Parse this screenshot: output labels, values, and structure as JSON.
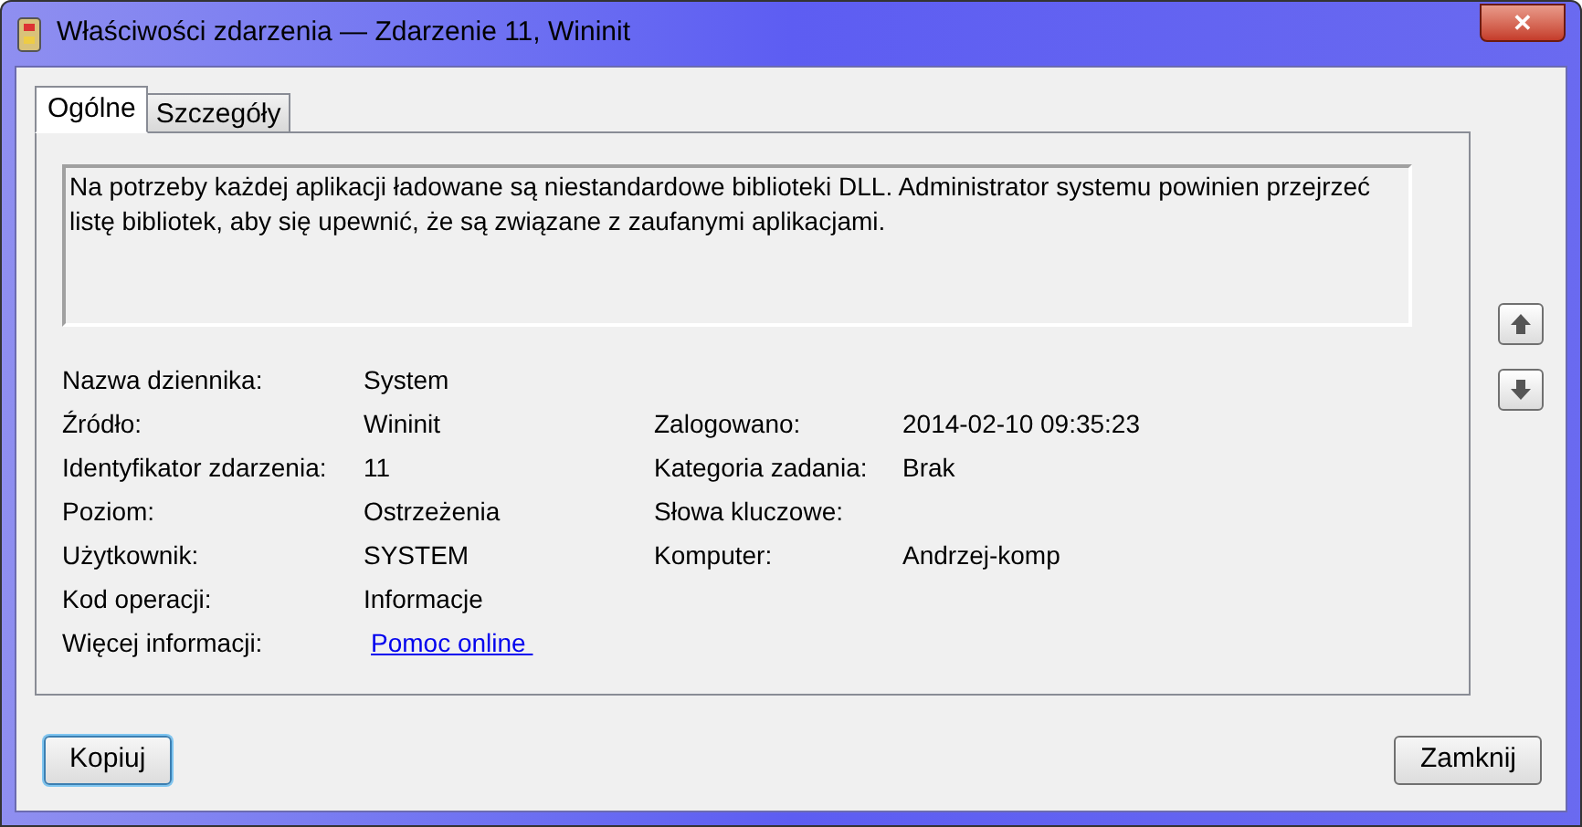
{
  "window": {
    "title": "Właściwości zdarzenia — Zdarzenie 11, Wininit",
    "close": "✕"
  },
  "tabs": [
    {
      "label": "Ogólne",
      "selected": true
    },
    {
      "label": "Szczegóły",
      "selected": false
    }
  ],
  "description": "Na potrzeby każdej aplikacji ładowane są niestandardowe biblioteki DLL. Administrator systemu powinien przejrzeć listę bibliotek, aby się upewnić, że są związane z zaufanymi aplikacjami.",
  "fields_left": [
    {
      "label": "Nazwa dziennika:",
      "value": "System",
      "kind": "text"
    },
    {
      "label": "Źródło:",
      "value": "Wininit",
      "kind": "text"
    },
    {
      "label": "Identyfikator zdarzenia:",
      "value": "11",
      "kind": "text"
    },
    {
      "label": "Poziom:",
      "value": "Ostrzeżenia",
      "kind": "text"
    },
    {
      "label": "Użytkownik:",
      "value": "SYSTEM",
      "kind": "text"
    },
    {
      "label": "Kod operacji:",
      "value": "Informacje",
      "kind": "text"
    },
    {
      "label": "Więcej informacji:",
      "value": "Pomoc online ",
      "kind": "link"
    }
  ],
  "fields_right": [
    {
      "label": "Zalogowano:",
      "value": "2014-02-10 09:35:23"
    },
    {
      "label": "Kategoria zadania:",
      "value": "Brak"
    },
    {
      "label": "Słowa kluczowe:"
    },
    {
      "label": "Komputer:",
      "value": "Andrzej-komp"
    }
  ],
  "buttons": [
    {
      "label": "Kopiuj",
      "focused": true
    },
    {
      "label": "Zamknij",
      "focused": false
    }
  ]
}
